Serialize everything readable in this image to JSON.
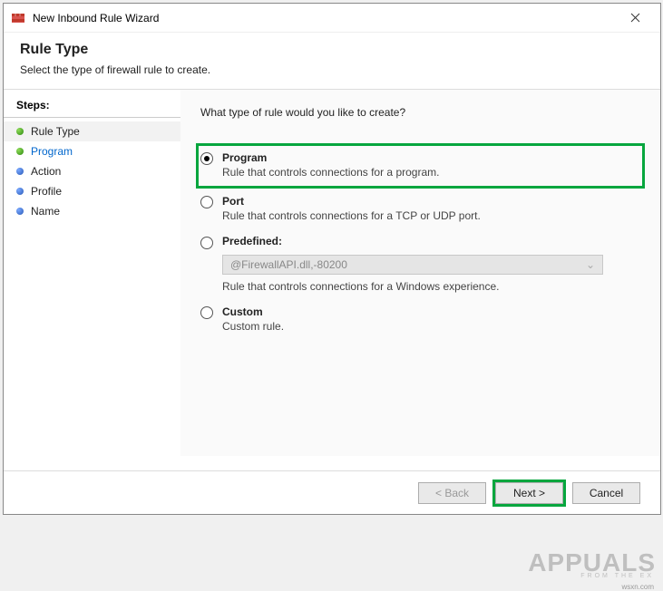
{
  "titlebar": {
    "title": "New Inbound Rule Wizard"
  },
  "header": {
    "title": "Rule Type",
    "subtitle": "Select the type of firewall rule to create."
  },
  "steps": {
    "title": "Steps:",
    "items": [
      {
        "label": "Rule Type",
        "bulletColor": "green",
        "active": true
      },
      {
        "label": "Program",
        "bulletColor": "green",
        "link": true
      },
      {
        "label": "Action",
        "bulletColor": "blue"
      },
      {
        "label": "Profile",
        "bulletColor": "blue"
      },
      {
        "label": "Name",
        "bulletColor": "blue"
      }
    ]
  },
  "main": {
    "question": "What type of rule would you like to create?",
    "options": {
      "program": {
        "label": "Program",
        "desc": "Rule that controls connections for a program."
      },
      "port": {
        "label": "Port",
        "desc": "Rule that controls connections for a TCP or UDP port."
      },
      "predefined": {
        "label": "Predefined:",
        "select_value": "@FirewallAPI.dll,-80200",
        "desc": "Rule that controls connections for a Windows experience."
      },
      "custom": {
        "label": "Custom",
        "desc": "Custom rule."
      }
    }
  },
  "buttons": {
    "back": "< Back",
    "next": "Next >",
    "cancel": "Cancel"
  },
  "watermark": {
    "main": "APPUALS",
    "sub": "FROM THE EX",
    "site": "wsxn.com"
  }
}
